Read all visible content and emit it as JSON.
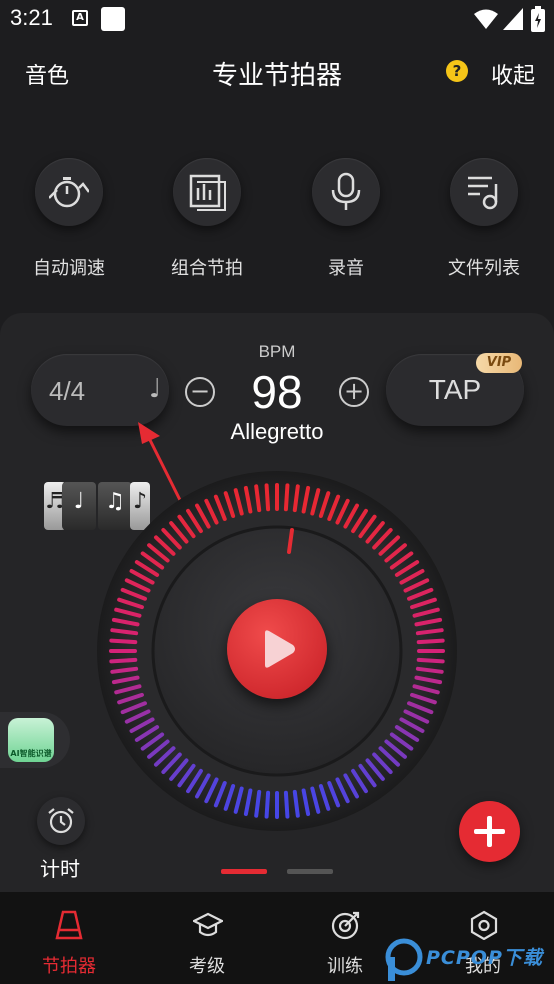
{
  "status_bar": {
    "time": "3:21",
    "notif_icon": "A"
  },
  "header": {
    "left": "音色",
    "title": "专业节拍器",
    "help": "?",
    "right": "收起"
  },
  "tools": [
    {
      "label": "自动调速",
      "icon": "stopwatch-speed-icon"
    },
    {
      "label": "组合节拍",
      "icon": "bar-chart-icon"
    },
    {
      "label": "录音",
      "icon": "microphone-icon"
    },
    {
      "label": "文件列表",
      "icon": "music-list-icon"
    }
  ],
  "metronome": {
    "time_signature": "4/4",
    "note": "♩",
    "bpm_label": "BPM",
    "bpm": "98",
    "tempo": "Allegretto",
    "minus": "−",
    "plus": "+",
    "tap": "TAP",
    "vip": "VIP"
  },
  "note_cards": [
    "♬",
    "♩",
    "♫",
    "♪"
  ],
  "ai_badge": "AI智能识谱",
  "timer_label": "计时",
  "fab": "+",
  "nav": [
    {
      "label": "节拍器",
      "icon": "metronome-icon",
      "active": true
    },
    {
      "label": "考级",
      "icon": "graduation-cap-icon",
      "active": false
    },
    {
      "label": "训练",
      "icon": "target-icon",
      "active": false
    },
    {
      "label": "我的",
      "icon": "hexagon-gear-icon",
      "active": false
    }
  ],
  "watermark": "PCPOP下载",
  "colors": {
    "accent": "#e52b33",
    "background": "#1d1d1f",
    "card": "#252527"
  }
}
